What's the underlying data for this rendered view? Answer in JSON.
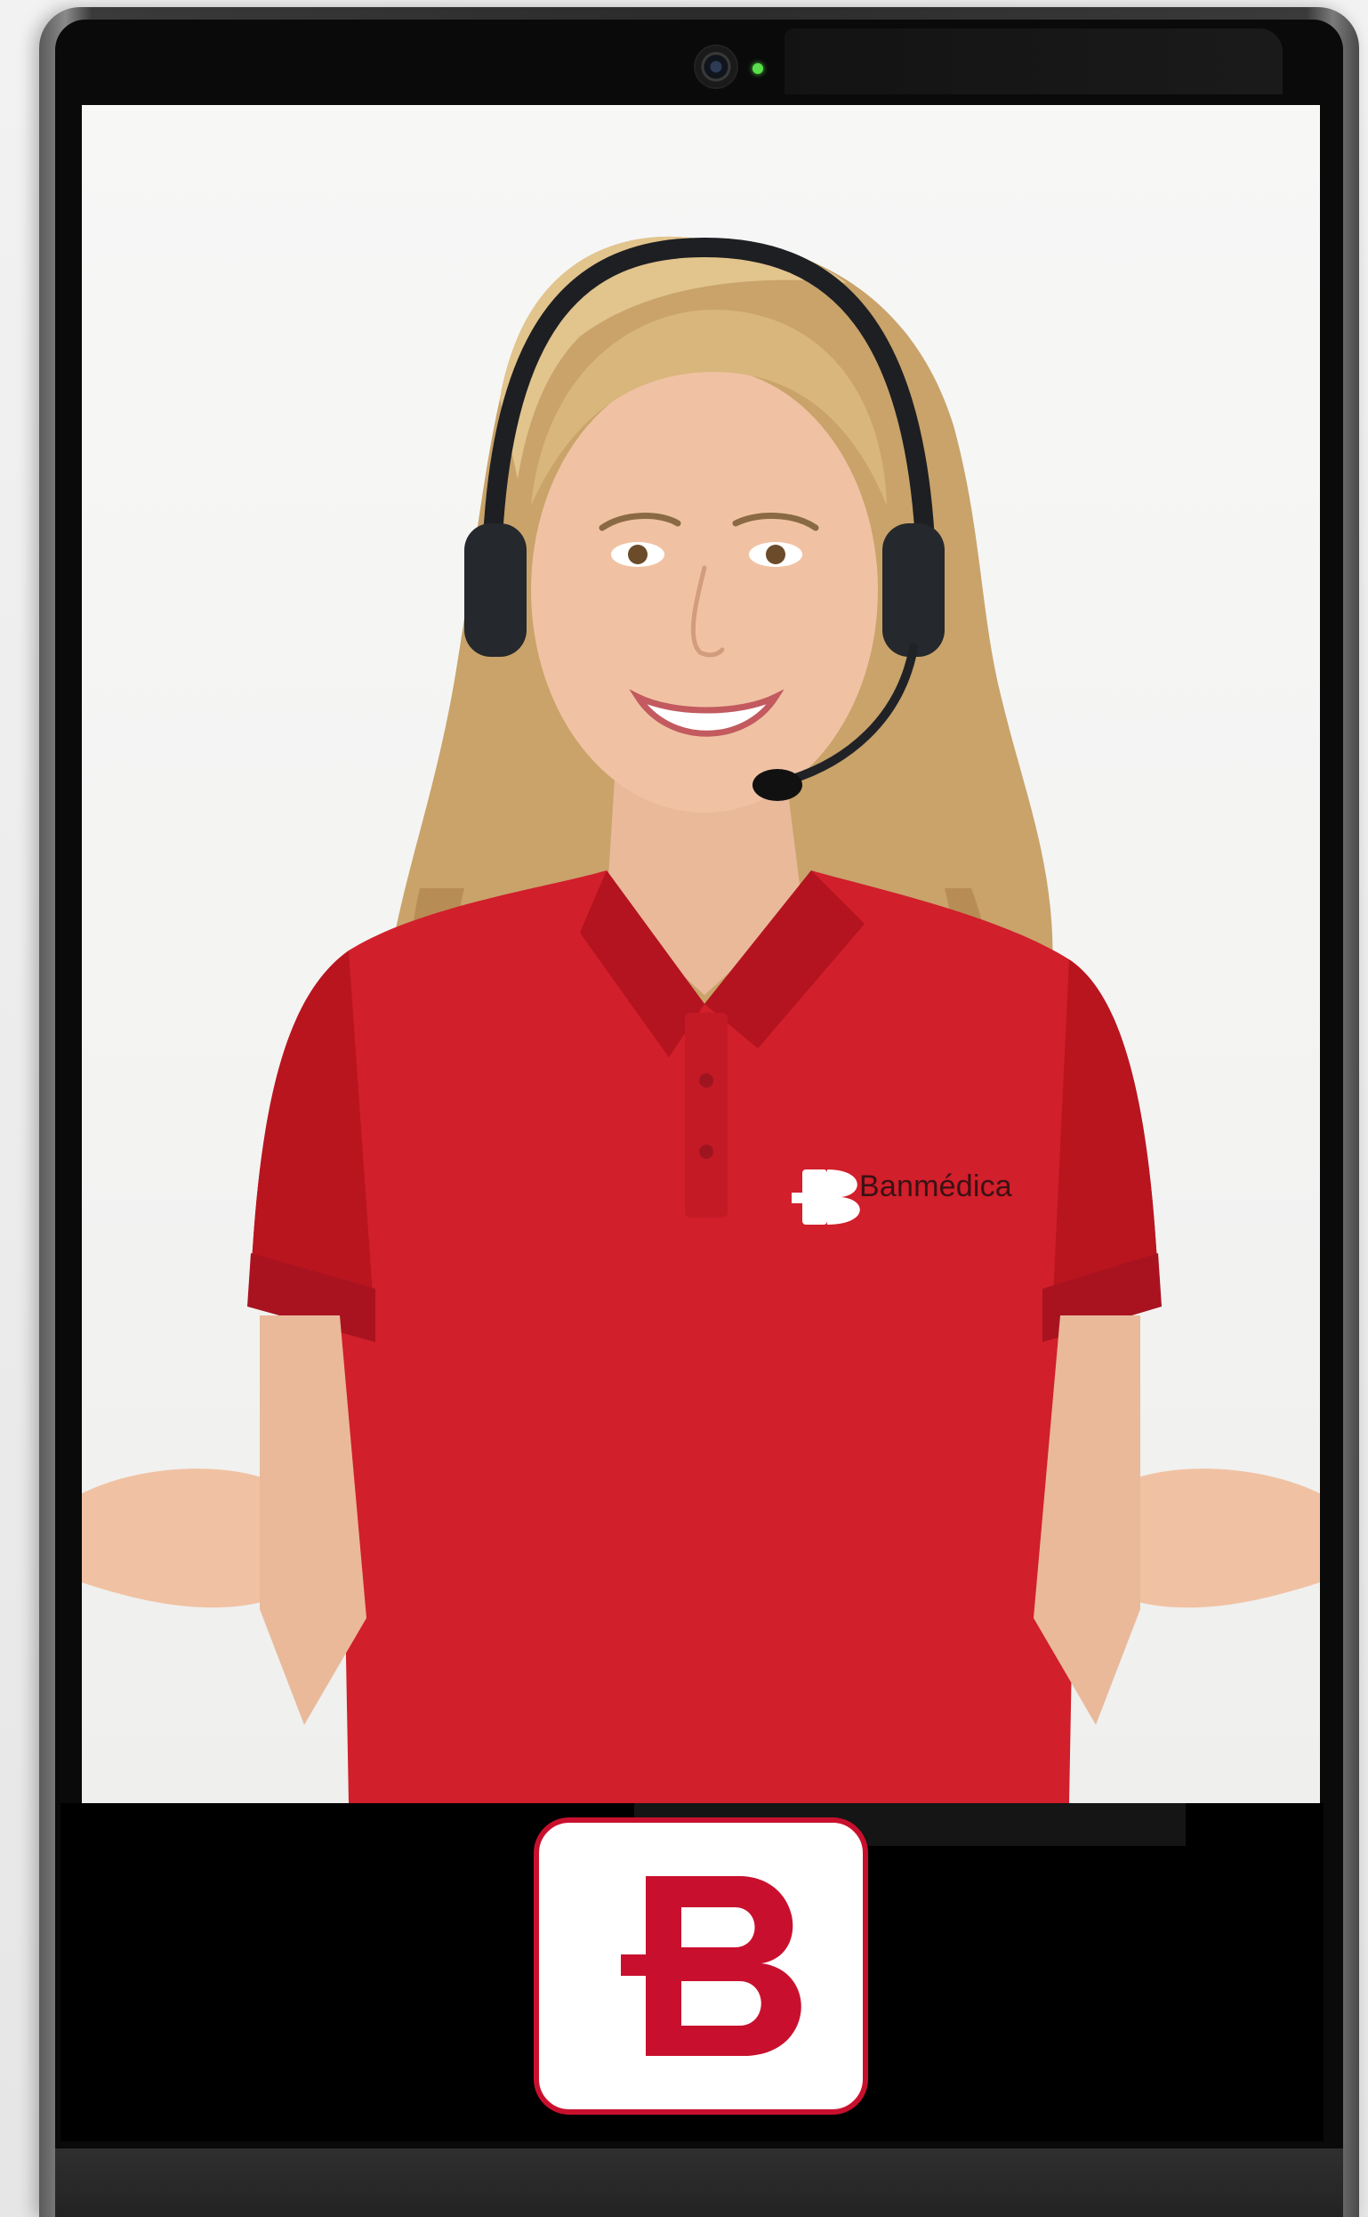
{
  "device": {
    "type": "tablet",
    "camera_led_color": "#58e04c"
  },
  "screen": {
    "content": "video-call-agent",
    "shirt_brand": "Banmédica",
    "colors": {
      "brand_red": "#c8102e",
      "shirt_red": "#d11f2b",
      "background": "#f4f4f3"
    }
  },
  "app_icon": {
    "icon": "banmedica-b-logo-icon",
    "accent": "#c8102e"
  }
}
